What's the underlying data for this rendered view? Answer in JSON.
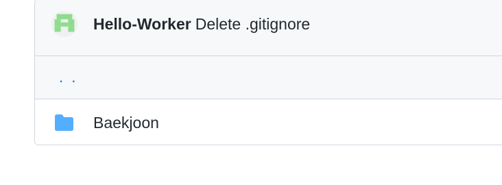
{
  "commit": {
    "author": "Hello-Worker",
    "message": "Delete .gitignore",
    "avatar_colors": {
      "fg": "#8fdc8f",
      "bg": "#f0f0f0"
    }
  },
  "parent_directory": {
    "label": ". ."
  },
  "files": [
    {
      "type": "folder",
      "name": "Baekjoon",
      "icon": "folder-icon",
      "icon_color": "#54aeff"
    }
  ],
  "colors": {
    "link": "#0969da",
    "border": "#d0d7de",
    "header_bg": "#f6f8fa",
    "text": "#24292f"
  }
}
